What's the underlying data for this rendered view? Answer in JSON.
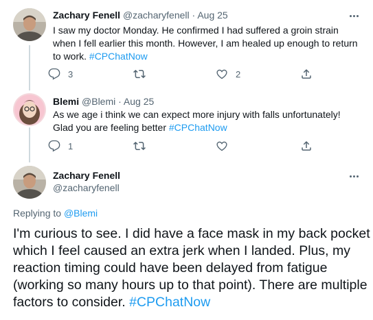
{
  "tweets": [
    {
      "name": "Zachary Fenell",
      "handle": "@zacharyfenell",
      "date": "Aug 25",
      "text": "I saw my doctor Monday. He confirmed I had suffered a groin strain when I fell earlier this month. However, I am healed up enough to return to work.",
      "hashtag": "#CPChatNow",
      "reply_count": "3",
      "retweet_count": "",
      "like_count": "2"
    },
    {
      "name": "Blemi",
      "handle": "@Blemi",
      "date": "Aug 25",
      "text": "As we age i think we can expect more injury with falls unfortunately! Glad you are feeling better",
      "hashtag": "#CPChatNow",
      "reply_count": "1",
      "retweet_count": "",
      "like_count": ""
    }
  ],
  "separator": "·",
  "main": {
    "name": "Zachary Fenell",
    "handle": "@zacharyfenell",
    "replying_prefix": "Replying to",
    "replying_to": "@Blemi",
    "text": "I'm curious to see. I did have a face mask in my back pocket which I feel caused an extra jerk when I landed. Plus, my reaction timing could have been delayed from fatigue (working so many hours up to that point). There are multiple factors to consider.",
    "hashtag": "#CPChatNow"
  },
  "colors": {
    "accent": "#1d9bf0",
    "muted": "#536471",
    "text": "#0f1419"
  }
}
